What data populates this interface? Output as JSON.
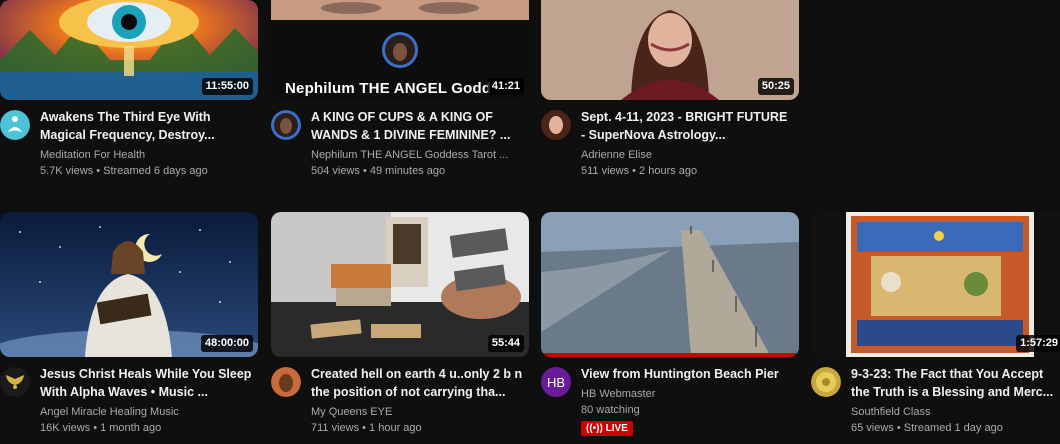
{
  "videos": [
    {
      "title": "Awakens The Third Eye With Magical Frequency, Destroy...",
      "channel": "Meditation For Health",
      "meta": "5.7K views • Streamed 6 days ago",
      "duration": "11:55:00"
    },
    {
      "overlay": "Nephilum THE ANGEL Godd",
      "title": "A KING OF CUPS & A KING OF WANDS & 1 DIVINE FEMININE? ...",
      "channel": "Nephilum THE ANGEL Goddess Tarot ...",
      "meta": "504 views • 49 minutes ago",
      "duration": "41:21"
    },
    {
      "title": "Sept. 4-11, 2023 - BRIGHT FUTURE - SuperNova Astrology...",
      "channel": "Adrienne Elise",
      "meta": "511 views • 2 hours ago",
      "duration": "50:25"
    },
    {
      "title": "Jesus Christ Heals While You Sleep With Alpha Waves • Music ...",
      "channel": "Angel Miracle Healing Music",
      "meta": "16K views • 1 month ago",
      "duration": "48:00:00"
    },
    {
      "title": "Created hell on earth 4 u..only 2 b n the position of not carrying tha...",
      "channel": "My Queens EYE",
      "meta": "711 views • 1 hour ago",
      "duration": "55:44"
    },
    {
      "title": "View from Huntington Beach Pier",
      "channel": "HB Webmaster",
      "meta": "80 watching",
      "live": "LIVE",
      "avatar_initials": "HB"
    },
    {
      "title": "9-3-23: The Fact that You Accept the Truth is a Blessing and Merc...",
      "channel": "Southfield Class",
      "meta": "65 views • Streamed 1 day ago",
      "duration": "1:57:29"
    }
  ],
  "colors": {
    "background": "#0f0f0f",
    "live": "#cc0000",
    "hb_avatar": "#6a1b9a"
  }
}
